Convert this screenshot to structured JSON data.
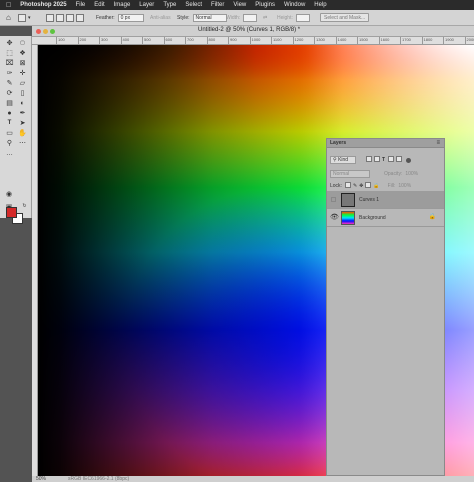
{
  "menubar": {
    "app": "Photoshop 2025",
    "items": [
      "File",
      "Edit",
      "Image",
      "Layer",
      "Type",
      "Select",
      "Filter",
      "View",
      "Plugins",
      "Window",
      "Help"
    ]
  },
  "options": {
    "feather_label": "Feather:",
    "feather_value": "0 px",
    "anti_alias": "Anti-alias",
    "style_label": "Style:",
    "style_value": "Normal",
    "width_label": "Width:",
    "height_label": "Height:",
    "select_mask": "Select and Mask..."
  },
  "document": {
    "tab_title": "Untitled-2 @ 50% (Curves 1, RGB/8) *",
    "zoom": "50%",
    "doc_info": "sRGB IEC61966-2.1 (8bpc)"
  },
  "ruler": {
    "top_ticks": [
      "100",
      "200",
      "300",
      "400",
      "500",
      "600",
      "700",
      "800",
      "900",
      "1000",
      "1100",
      "1200",
      "1300",
      "1400",
      "1500",
      "1600",
      "1700",
      "1800",
      "1900",
      "2000"
    ]
  },
  "layers_panel": {
    "title": "Layers",
    "filter_kind": "Kind",
    "blend_mode": "Normal",
    "opacity_label": "Opacity:",
    "opacity_value": "100%",
    "lock_label": "Lock:",
    "fill_label": "Fill:",
    "fill_value": "100%",
    "layers": [
      {
        "name": "Curves 1",
        "visible": false
      },
      {
        "name": "Background",
        "visible": true,
        "locked": true
      }
    ]
  },
  "colors": {
    "foreground": "#d42a2a",
    "background": "#ffffff"
  }
}
